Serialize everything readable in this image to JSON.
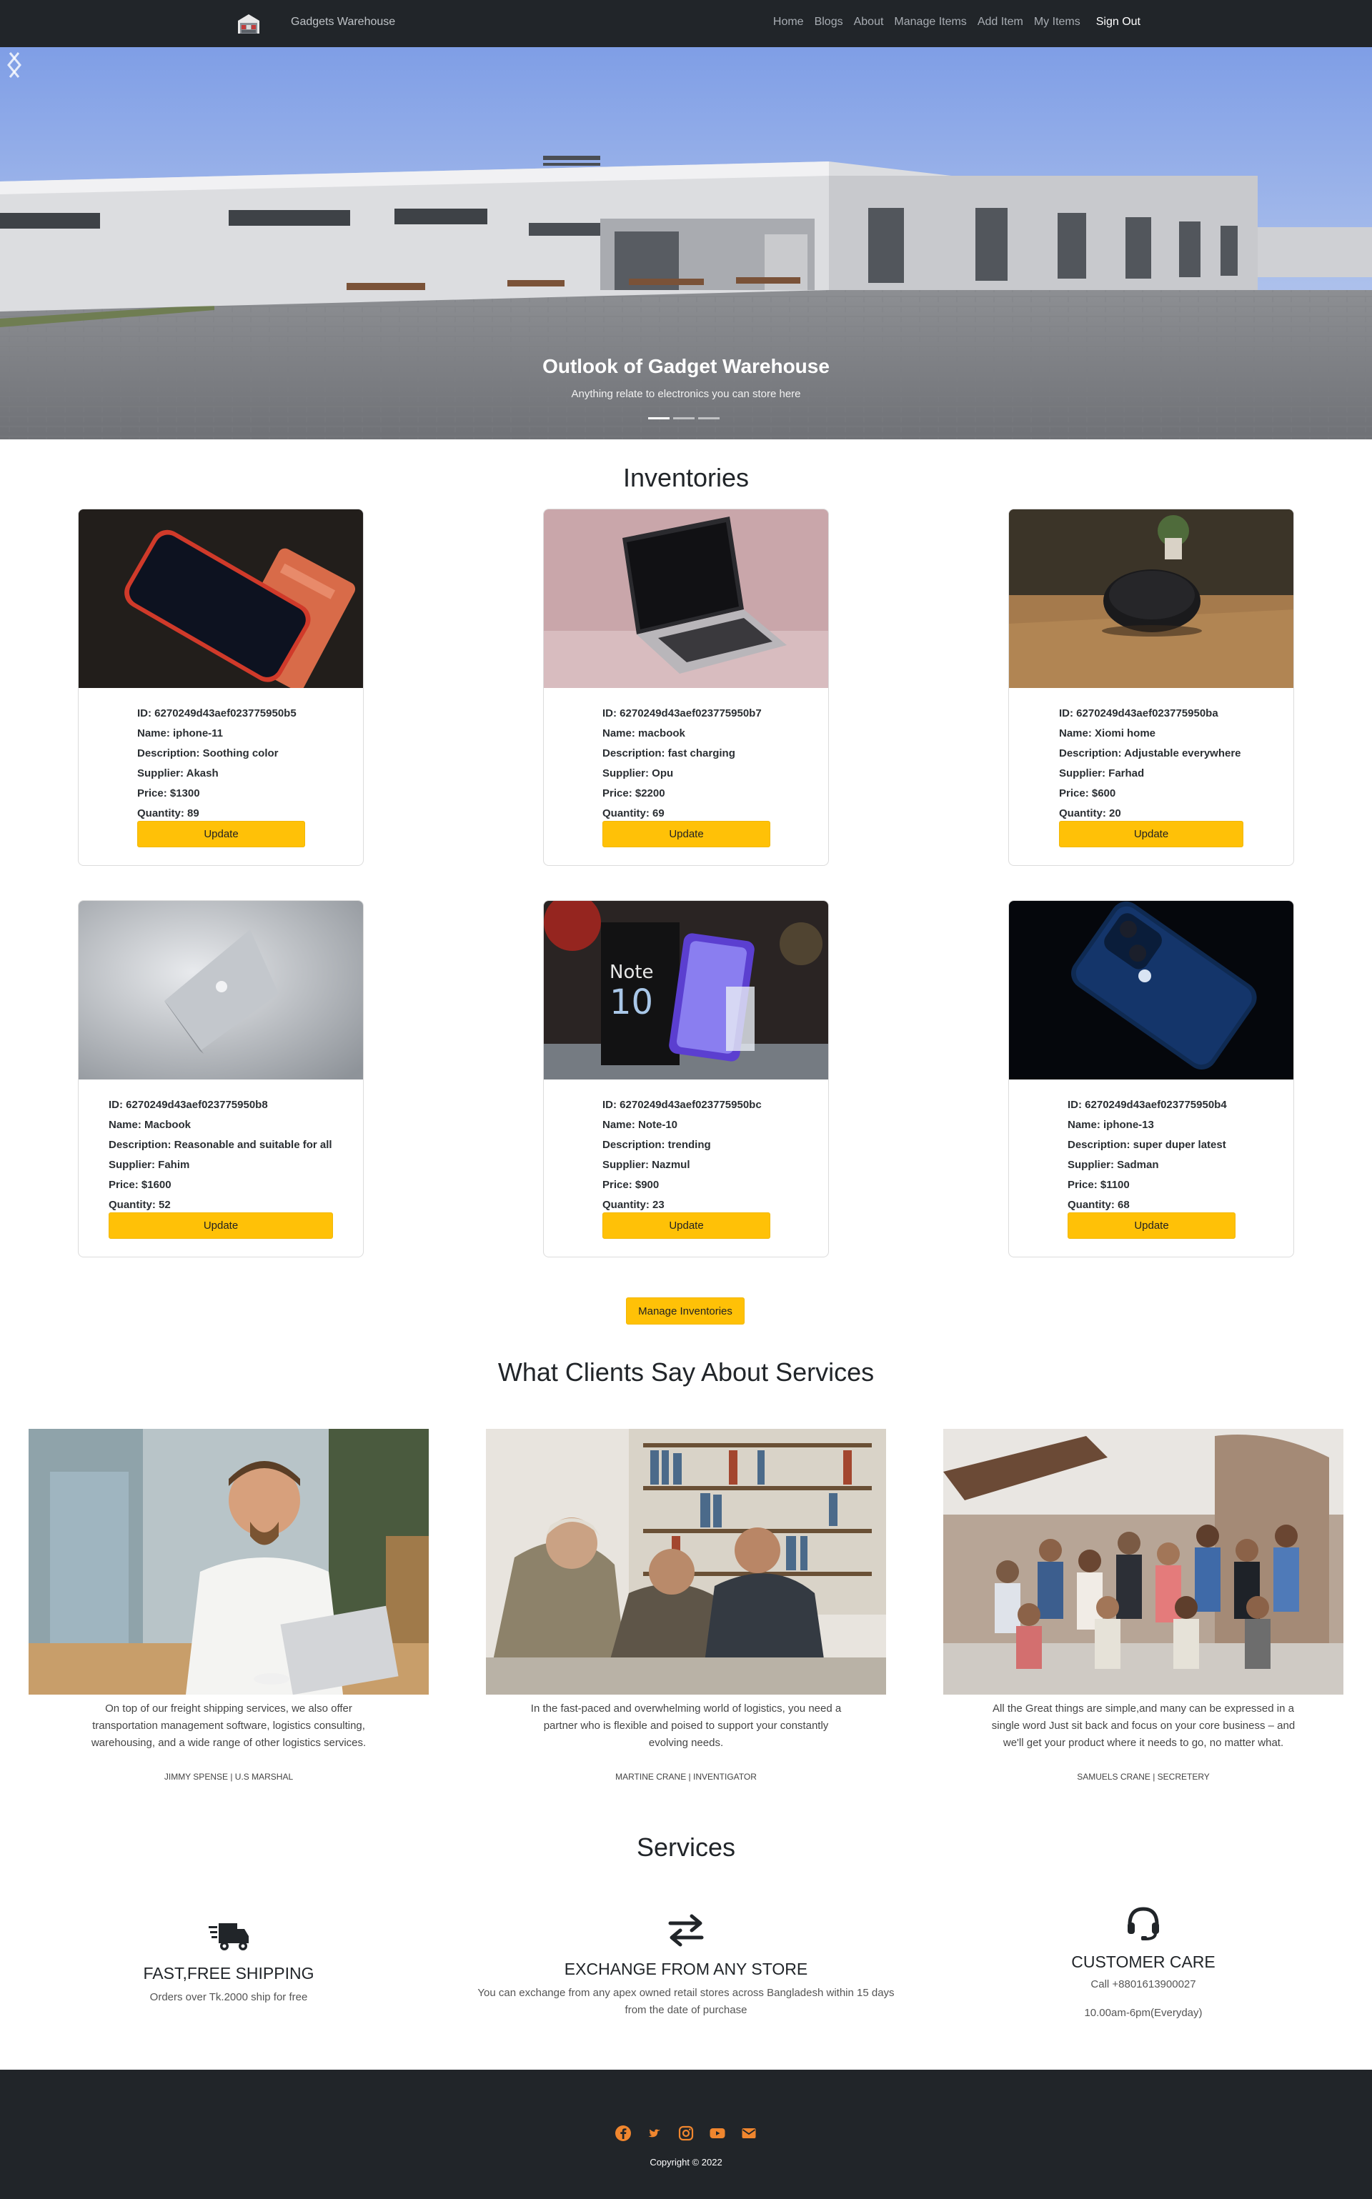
{
  "navbar": {
    "brand": "Gadgets Warehouse",
    "links": [
      "Home",
      "Blogs",
      "About",
      "Manage Items",
      "Add Item",
      "My Items"
    ],
    "signout": "Sign Out"
  },
  "hero": {
    "title": "Outlook of Gadget Warehouse",
    "subtitle": "Anything relate to electronics you can store here",
    "slides_count": 3,
    "active_slide": 1
  },
  "inventories": {
    "title": "Inventories",
    "update_label": "Update",
    "items": [
      {
        "id": "ID: 6270249d43aef023775950b5",
        "name": "Name: iphone-11",
        "description": "Description: Soothing color",
        "supplier": "Supplier: Akash",
        "price": "Price: $1300",
        "quantity": "Quantity: 89"
      },
      {
        "id": "ID: 6270249d43aef023775950b7",
        "name": "Name: macbook",
        "description": "Description: fast charging",
        "supplier": "Supplier: Opu",
        "price": "Price: $2200",
        "quantity": "Quantity: 69"
      },
      {
        "id": "ID: 6270249d43aef023775950ba",
        "name": "Name: Xiomi home",
        "description": "Description: Adjustable everywhere",
        "supplier": "Supplier: Farhad",
        "price": "Price: $600",
        "quantity": "Quantity: 20"
      },
      {
        "id": "ID: 6270249d43aef023775950b8",
        "name": "Name: Macbook",
        "description": "Description: Reasonable and suitable for all",
        "supplier": "Supplier: Fahim",
        "price": "Price: $1600",
        "quantity": "Quantity: 52"
      },
      {
        "id": "ID: 6270249d43aef023775950bc",
        "name": "Name: Note-10",
        "description": "Description: trending",
        "supplier": "Supplier: Nazmul",
        "price": "Price: $900",
        "quantity": "Quantity: 23"
      },
      {
        "id": "ID: 6270249d43aef023775950b4",
        "name": "Name: iphone-13",
        "description": "Description: super duper latest",
        "supplier": "Supplier: Sadman",
        "price": "Price: $1100",
        "quantity": "Quantity: 68"
      }
    ],
    "manage_label": "Manage Inventories"
  },
  "testimonials": {
    "title": "What Clients Say About Services",
    "items": [
      {
        "quote": "On top of our freight shipping services, we also offer transportation management software, logistics consulting, warehousing, and a wide range of other logistics services.",
        "author": "JIMMY SPENSE | U.S MARSHAL"
      },
      {
        "quote": "In the fast-paced and overwhelming world of logistics, you need a partner who is flexible and poised to support your constantly evolving needs.",
        "author": "MARTINE CRANE | INVENTIGATOR"
      },
      {
        "quote": "All the Great things are simple,and many can be expressed in a single word Just sit back and focus on your core business – and we'll get your product where it needs to go, no matter what.",
        "author": "SAMUELS CRANE | SECRETERY"
      }
    ]
  },
  "services": {
    "title": "Services",
    "items": [
      {
        "icon": "truck-icon",
        "title": "FAST,FREE SHIPPING",
        "lines": [
          "Orders over Tk.2000 ship for free"
        ]
      },
      {
        "icon": "exchange-icon",
        "title": "EXCHANGE FROM ANY STORE",
        "lines": [
          "You can exchange from any apex owned retail stores across Bangladesh within 15 days",
          "from the date of purchase"
        ]
      },
      {
        "icon": "headset-icon",
        "title": "CUSTOMER CARE",
        "lines": [
          "Call +8801613900027",
          "10.00am-6pm(Everyday)"
        ]
      }
    ]
  },
  "footer": {
    "socials": [
      "facebook-icon",
      "twitter-icon",
      "instagram-icon",
      "youtube-icon",
      "envelope-icon"
    ],
    "accent": "#f0862e",
    "copyright": "Copyright © 2022"
  }
}
